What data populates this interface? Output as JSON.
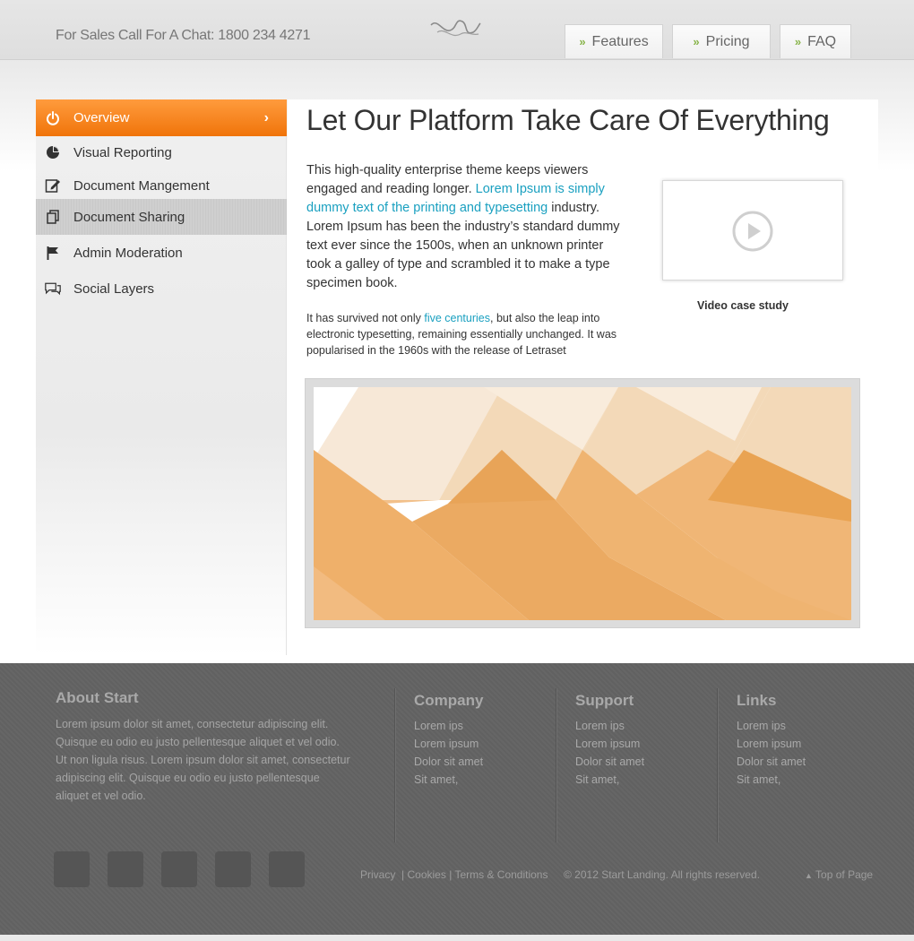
{
  "header": {
    "sales_text": "For Sales Call For A Chat: 1800 234 4271",
    "nav": [
      {
        "label": "Features"
      },
      {
        "label": "Pricing"
      },
      {
        "label": "FAQ"
      }
    ]
  },
  "sidebar": {
    "items": [
      {
        "label": "Overview",
        "icon": "power-icon",
        "state": "active"
      },
      {
        "label": "Visual Reporting",
        "icon": "pie-chart-icon"
      },
      {
        "label": "Document Mangement",
        "icon": "edit-document-icon"
      },
      {
        "label": "Document Sharing",
        "icon": "copy-documents-icon",
        "state": "hover"
      },
      {
        "label": "Admin Moderation",
        "icon": "flag-icon"
      },
      {
        "label": "Social Layers",
        "icon": "speech-bubbles-icon"
      }
    ]
  },
  "main": {
    "headline": "Let Our Platform Take Care Of Everything",
    "para1_start": "This high-quality enterprise theme keeps viewers engaged and reading longer.",
    "para1_link": "Lorem Ipsum is simply dummy text of the printing and typesetting",
    "para1_end": "industry. Lorem Ipsum has been the industry’s standard dummy text ever since the 1500s, when an unknown printer took a galley of type and scrambled it to make a type specimen book.",
    "para2_start": "It has survived not only",
    "para2_link": "five centuries",
    "para2_end": ", but also the leap into electronic typesetting, remaining essentially unchanged. It was popularised in the 1960s with the release of Letraset",
    "video_caption": "Video case study"
  },
  "footer": {
    "about_title": "About Start",
    "about_text": "Lorem ipsum dolor sit amet, consectetur adipiscing elit. Quisque eu odio eu justo pellentesque aliquet et vel odio. Ut non ligula risus.  Lorem ipsum dolor sit amet, consectetur adipiscing elit. Quisque eu odio eu justo pellentesque aliquet et vel odio.",
    "columns": [
      {
        "title": "Company",
        "links": [
          "Lorem ips",
          "Lorem ipsum",
          "Dolor sit amet",
          "Sit amet,"
        ]
      },
      {
        "title": "Support",
        "links": [
          "Lorem ips",
          "Lorem ipsum",
          "Dolor sit amet",
          "Sit amet,"
        ]
      },
      {
        "title": "Links",
        "links": [
          "Lorem ips",
          "Lorem ipsum",
          "Dolor sit amet",
          "Sit amet,"
        ]
      }
    ],
    "legal": {
      "privacy": "Privacy",
      "cookies": "Cookies",
      "terms": "Terms & Conditions",
      "copyright": "© 2012 Start Landing. All rights reserved.",
      "top": "Top of Page"
    }
  }
}
